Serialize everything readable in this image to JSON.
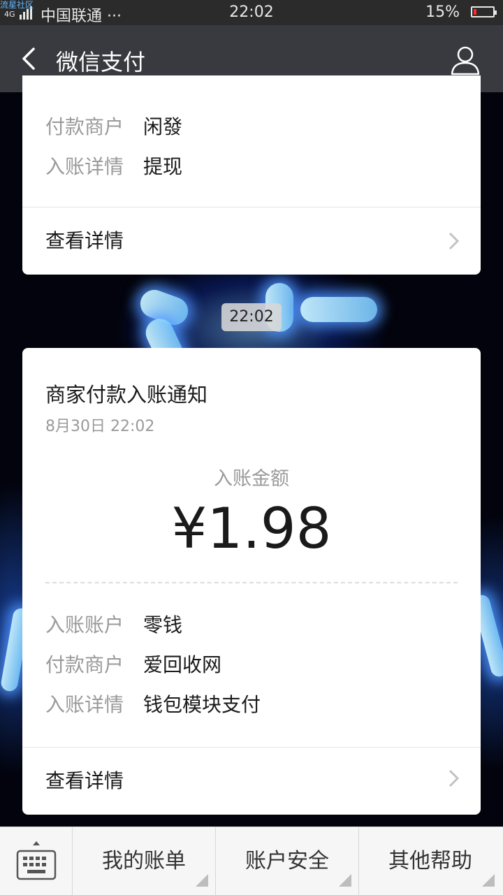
{
  "status_bar": {
    "watermark": "流星社区",
    "network": "4G",
    "carrier": "中国联通 ···",
    "time": "22:02",
    "battery_percent": "15%",
    "battery_level": 0.15,
    "battery_color": "#ff2a2a"
  },
  "nav": {
    "back_icon": "back-arrow-icon",
    "title": "微信支付",
    "profile_icon": "user-icon"
  },
  "card_prev": {
    "rows": [
      {
        "label": "付款商户",
        "value": "闲發"
      },
      {
        "label": "入账详情",
        "value": "提现"
      }
    ],
    "detail_label": "查看详情"
  },
  "timestamp_pill": "22:02",
  "card_current": {
    "title": "商家付款入账通知",
    "datetime": "8月30日  22:02",
    "amount_label": "入账金额",
    "amount": "¥1.98",
    "rows": [
      {
        "label": "入账账户",
        "value": "零钱"
      },
      {
        "label": "付款商户",
        "value": "爱回收网"
      },
      {
        "label": "入账详情",
        "value": "钱包模块支付"
      }
    ],
    "detail_label": "查看详情"
  },
  "bottom_menu": {
    "keyboard_icon": "keyboard-icon",
    "items": [
      "我的账单",
      "账户安全",
      "其他帮助"
    ]
  },
  "colors": {
    "status_bar": "#2b2b2b",
    "nav_bar": "#393a3f",
    "card": "#ffffff",
    "label_gray": "#9a9a9a",
    "menu_bg": "#f6f6f6"
  }
}
